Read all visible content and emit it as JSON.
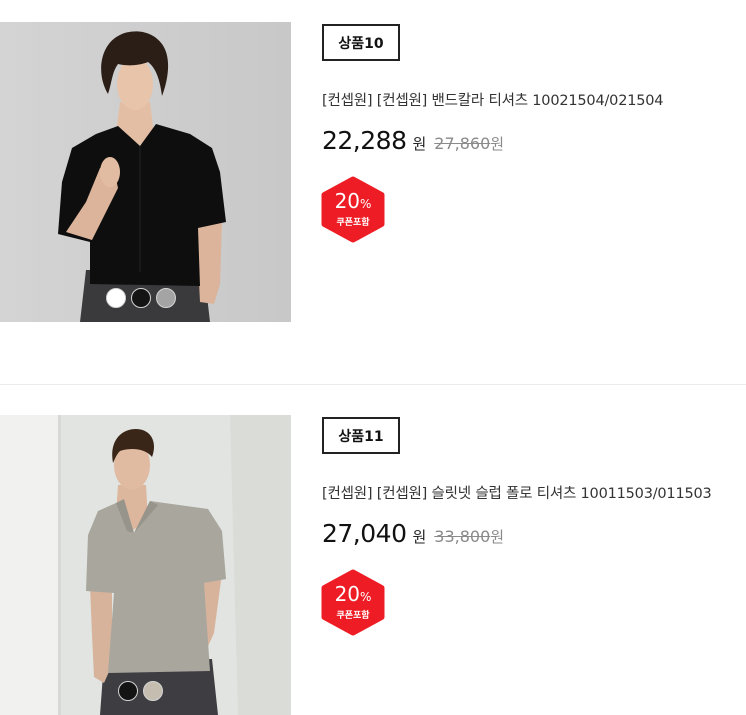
{
  "products": [
    {
      "badge": "상품10",
      "title": "[컨셉원] [컨셉원] 밴드칼라 티셔츠 10021504/021504",
      "price": "22,288",
      "price_unit": "원",
      "original_price": "27,860",
      "original_unit": "원",
      "discount_value": "20",
      "discount_unit": "%",
      "coupon_label": "쿠폰포함",
      "color_swatches": [
        "#ffffff",
        "#141414",
        "#a4a4a4"
      ]
    },
    {
      "badge": "상품11",
      "title": "[컨셉원] [컨셉원] 슬릿넷 슬럽 폴로 티셔츠 10011503/011503",
      "price": "27,040",
      "price_unit": "원",
      "original_price": "33,800",
      "original_unit": "원",
      "discount_value": "20",
      "discount_unit": "%",
      "coupon_label": "쿠폰포함",
      "color_swatches": [
        "#141414",
        "#c5bdb0"
      ]
    }
  ],
  "colors": {
    "discount_badge": "#ee1c24",
    "muted_price": "#8a8a8a",
    "divider": "#ececec",
    "text": "#1a1a1a"
  }
}
